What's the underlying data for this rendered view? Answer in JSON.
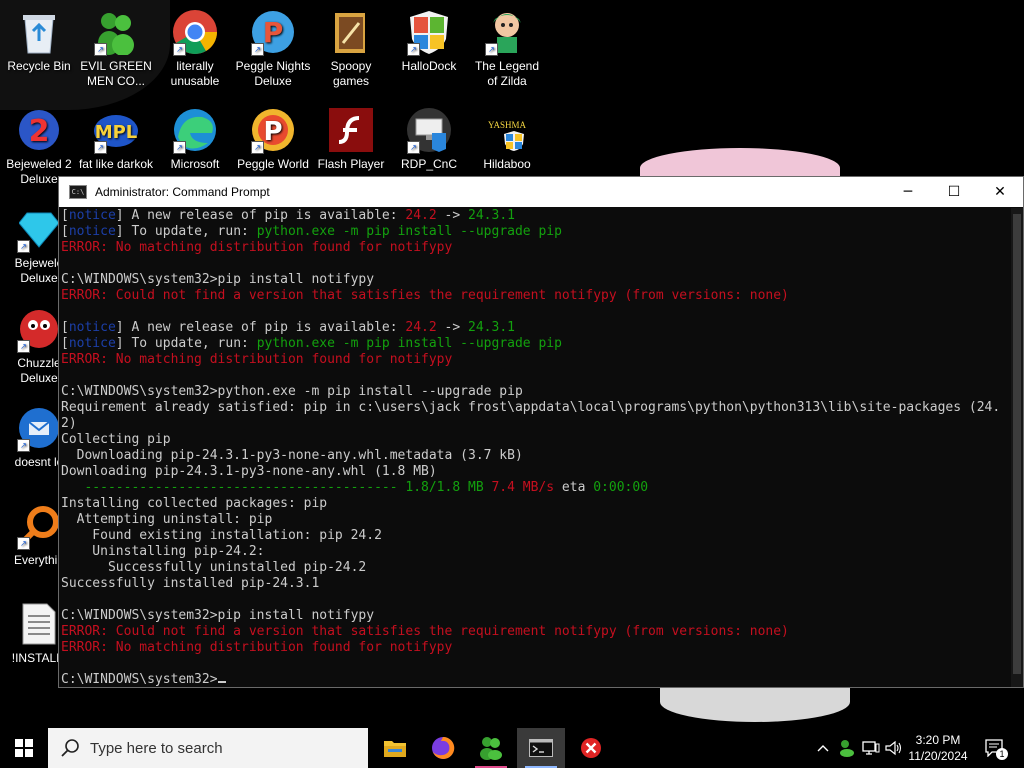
{
  "desktop": {
    "icons": [
      {
        "label": "Recycle Bin"
      },
      {
        "label": "EVIL GREEN MEN CO..."
      },
      {
        "label": "literally unusable"
      },
      {
        "label": "Peggle Nights Deluxe"
      },
      {
        "label": "Spoopy games"
      },
      {
        "label": "HalloDock"
      },
      {
        "label": "The Legend of Zilda"
      },
      {
        "label": "Bejeweled 2 Deluxe"
      },
      {
        "label": "fat like darkok"
      },
      {
        "label": "Microsoft"
      },
      {
        "label": "Peggle World"
      },
      {
        "label": "Flash Player"
      },
      {
        "label": "RDP_CnC"
      },
      {
        "label": "Hildaboo"
      },
      {
        "label": "Bejewele Deluxe"
      },
      {
        "label": "Chuzzle Deluxe"
      },
      {
        "label": "doesnt lo"
      },
      {
        "label": "Everythin"
      },
      {
        "label": "!INSTALLI"
      }
    ],
    "hildaboo_badge": "YASHMA"
  },
  "window": {
    "title": "Administrator: Command Prompt",
    "minimize": "─",
    "maximize": "☐",
    "close": "✕",
    "icon_text": "C:\\"
  },
  "console": {
    "lines": [
      [
        {
          "t": "[",
          "c": "gray"
        },
        {
          "t": "notice",
          "c": "blue"
        },
        {
          "t": "] A new release of pip is available: ",
          "c": "gray"
        },
        {
          "t": "24.2",
          "c": "red"
        },
        {
          "t": " -> ",
          "c": "gray"
        },
        {
          "t": "24.3.1",
          "c": "green"
        }
      ],
      [
        {
          "t": "[",
          "c": "gray"
        },
        {
          "t": "notice",
          "c": "blue"
        },
        {
          "t": "] To update, run: ",
          "c": "gray"
        },
        {
          "t": "python.exe -m pip install --upgrade pip",
          "c": "green"
        }
      ],
      [
        {
          "t": "ERROR: No matching distribution found for notifypy",
          "c": "red"
        }
      ],
      [],
      [
        {
          "t": "C:\\WINDOWS\\system32>pip install notifypy",
          "c": "gray"
        }
      ],
      [
        {
          "t": "ERROR: Could not find a version that satisfies the requirement notifypy (from versions: none)",
          "c": "red"
        }
      ],
      [],
      [
        {
          "t": "[",
          "c": "gray"
        },
        {
          "t": "notice",
          "c": "blue"
        },
        {
          "t": "] A new release of pip is available: ",
          "c": "gray"
        },
        {
          "t": "24.2",
          "c": "red"
        },
        {
          "t": " -> ",
          "c": "gray"
        },
        {
          "t": "24.3.1",
          "c": "green"
        }
      ],
      [
        {
          "t": "[",
          "c": "gray"
        },
        {
          "t": "notice",
          "c": "blue"
        },
        {
          "t": "] To update, run: ",
          "c": "gray"
        },
        {
          "t": "python.exe -m pip install --upgrade pip",
          "c": "green"
        }
      ],
      [
        {
          "t": "ERROR: No matching distribution found for notifypy",
          "c": "red"
        }
      ],
      [],
      [
        {
          "t": "C:\\WINDOWS\\system32>python.exe -m pip install --upgrade pip",
          "c": "gray"
        }
      ],
      [
        {
          "t": "Requirement already satisfied: pip in c:\\users\\jack frost\\appdata\\local\\programs\\python\\python313\\lib\\site-packages (24.",
          "c": "gray"
        }
      ],
      [
        {
          "t": "2)",
          "c": "gray"
        }
      ],
      [
        {
          "t": "Collecting pip",
          "c": "gray"
        }
      ],
      [
        {
          "t": "  Downloading pip-24.3.1-py3-none-any.whl.metadata (3.7 kB)",
          "c": "gray"
        }
      ],
      [
        {
          "t": "Downloading pip-24.3.1-py3-none-any.whl (1.8 MB)",
          "c": "gray"
        }
      ],
      [
        {
          "t": "   ---------------------------------------- ",
          "c": "green"
        },
        {
          "t": "1.8/1.8 MB ",
          "c": "green"
        },
        {
          "t": "7.4 MB/s",
          "c": "red"
        },
        {
          "t": " eta ",
          "c": "gray"
        },
        {
          "t": "0:00:00",
          "c": "green"
        }
      ],
      [
        {
          "t": "Installing collected packages: pip",
          "c": "gray"
        }
      ],
      [
        {
          "t": "  Attempting uninstall: pip",
          "c": "gray"
        }
      ],
      [
        {
          "t": "    Found existing installation: pip 24.2",
          "c": "gray"
        }
      ],
      [
        {
          "t": "    Uninstalling pip-24.2:",
          "c": "gray"
        }
      ],
      [
        {
          "t": "      Successfully uninstalled pip-24.2",
          "c": "gray"
        }
      ],
      [
        {
          "t": "Successfully installed pip-24.3.1",
          "c": "gray"
        }
      ],
      [],
      [
        {
          "t": "C:\\WINDOWS\\system32>pip install notifypy",
          "c": "gray"
        }
      ],
      [
        {
          "t": "ERROR: Could not find a version that satisfies the requirement notifypy (from versions: none)",
          "c": "red"
        }
      ],
      [
        {
          "t": "ERROR: No matching distribution found for notifypy",
          "c": "red"
        }
      ],
      [],
      [
        {
          "t": "C:\\WINDOWS\\system32>",
          "c": "gray"
        }
      ]
    ]
  },
  "taskbar": {
    "search_placeholder": "Type here to search",
    "apps": [
      "file-explorer-icon",
      "firefox-icon",
      "evil-green-men-icon",
      "command-prompt-icon",
      "red-x-app-icon"
    ],
    "time": "3:20 PM",
    "date": "11/20/2024",
    "notification_count": "1"
  },
  "colors": {
    "notice_blue": "#1c3fa8",
    "error_red": "#c50f1f",
    "ok_green": "#13a10e",
    "console_gray": "#cccccc"
  }
}
